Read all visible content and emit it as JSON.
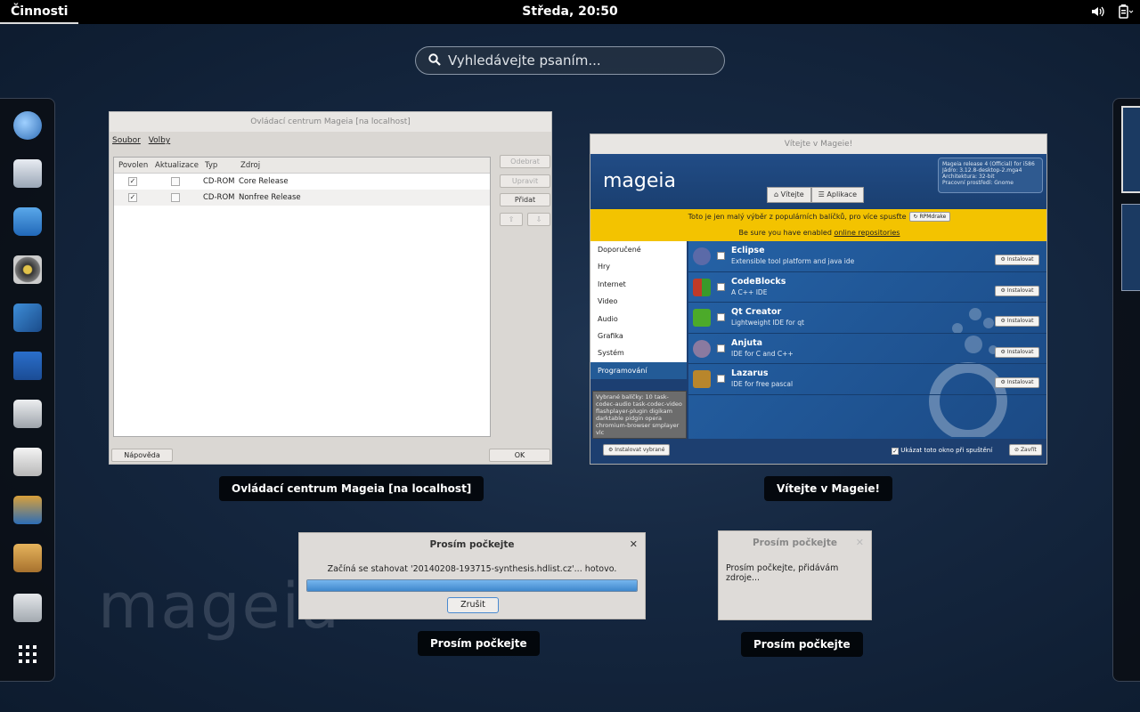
{
  "topbar": {
    "activities": "Činnosti",
    "clock": "Středa, 20:50"
  },
  "search": {
    "placeholder": "Vyhledávejte psaním..."
  },
  "dash": {
    "items": [
      "internet-browser-icon",
      "clock-settings-icon",
      "chat-icon",
      "speaker-icon",
      "photo-viewer-icon",
      "writer-document-icon",
      "file-cabinet-icon",
      "documents-icon",
      "tools-icon",
      "software-package-icon",
      "remote-desktop-icon",
      "show-applications-grid-icon"
    ]
  },
  "background": {
    "logo_text": "mageia"
  },
  "windows": {
    "control_center": {
      "title": "Ovládací centrum Mageia  [na localhost]",
      "caption": "Ovládací centrum Mageia  [na localhost]",
      "menu": [
        "Soubor",
        "Volby"
      ],
      "columns": [
        "Povolen",
        "Aktualizace",
        "Typ",
        "Zdroj"
      ],
      "rows": [
        {
          "enabled": true,
          "update": false,
          "type": "CD-ROM",
          "source": "Core Release"
        },
        {
          "enabled": true,
          "update": false,
          "type": "CD-ROM",
          "source": "Nonfree Release"
        }
      ],
      "buttons": {
        "remove": "Odebrat",
        "edit": "Upravit",
        "add": "Přidat",
        "help": "Nápověda",
        "ok": "OK"
      }
    },
    "welcome": {
      "title": "Vítejte v Mageie!",
      "caption": "Vítejte v Mageie!",
      "logo": "mageia",
      "release_info": "Mageia release 4 (Official) for i586\nJádro: 3.12.8-desktop-2.mga4\nArchitektura: 32-bit\nPracovní prostředí: Gnome",
      "tabs": [
        "Vítejte",
        "Aplikace"
      ],
      "banner_line1": "Toto je jen malý výběr z populárních balíčků, pro více spusťte",
      "rpmdrake_button": "RPMdrake",
      "banner_line2_prefix": "Be sure you have enabled ",
      "banner_link": "online repositories",
      "categories": [
        "Doporučené",
        "Hry",
        "Internet",
        "Video",
        "Audio",
        "Grafika",
        "Systém",
        "Programování"
      ],
      "selected_category": "Programování",
      "selected_packages": "Vybrané balíčky: 10 task-codec-audio task-codec-video flashplayer-plugin digikam darktable pidgin opera chromium-browser smplayer vlc",
      "apps": [
        {
          "name": "Eclipse",
          "desc": "Extensible tool platform and java ide",
          "color": "#5b6aa8"
        },
        {
          "name": "CodeBlocks",
          "desc": "A C++ IDE",
          "color": "#c03a28"
        },
        {
          "name": "Qt Creator",
          "desc": "Lightweight IDE for qt",
          "color": "#4caa2a"
        },
        {
          "name": "Anjuta",
          "desc": "IDE for C and C++",
          "color": "#8a7aa0"
        },
        {
          "name": "Lazarus",
          "desc": "IDE for free pascal",
          "color": "#b8862c"
        }
      ],
      "install_label": "Instalovat",
      "install_selected": "Instalovat vybrané",
      "show_on_startup": "Ukázat toto okno při spuštění",
      "close_label": "Zavřít"
    },
    "download_dialog": {
      "title": "Prosím počkejte",
      "caption": "Prosím počkejte",
      "message": "Začíná se stahovat '20140208-193715-synthesis.hdlist.cz'... hotovo.",
      "progress": 1.0,
      "cancel": "Zrušit"
    },
    "adding_dialog": {
      "title": "Prosím počkejte",
      "caption": "Prosím počkejte",
      "message": "Prosím počkejte, přidávám zdroje..."
    }
  },
  "colors": {
    "accent": "#3f87cc",
    "banner_yellow": "#f3c300",
    "welcome_blue": "#1c3f72"
  }
}
